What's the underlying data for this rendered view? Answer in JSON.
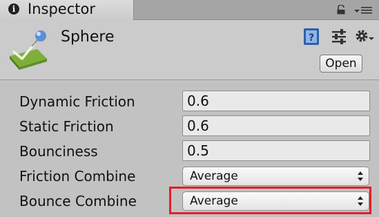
{
  "tab": {
    "title": "Inspector",
    "icon": "info-icon"
  },
  "toolbar": {
    "lock_icon": "lock-icon",
    "menu_icon": "menu-icon"
  },
  "header": {
    "object_name": "Sphere",
    "asset_icon": "physic-material-icon",
    "open_label": "Open",
    "icons": [
      "help-icon",
      "preset-icon",
      "gear-icon"
    ]
  },
  "properties": [
    {
      "label": "Dynamic Friction",
      "value": "0.6",
      "type": "float"
    },
    {
      "label": "Static Friction",
      "value": "0.6",
      "type": "float"
    },
    {
      "label": "Bounciness",
      "value": "0.5",
      "type": "float"
    },
    {
      "label": "Friction Combine",
      "value": "Average",
      "type": "dropdown"
    },
    {
      "label": "Bounce Combine",
      "value": "Average",
      "type": "dropdown"
    }
  ],
  "colors": {
    "highlight": "#e51e25",
    "background": "#c2c2c2"
  }
}
